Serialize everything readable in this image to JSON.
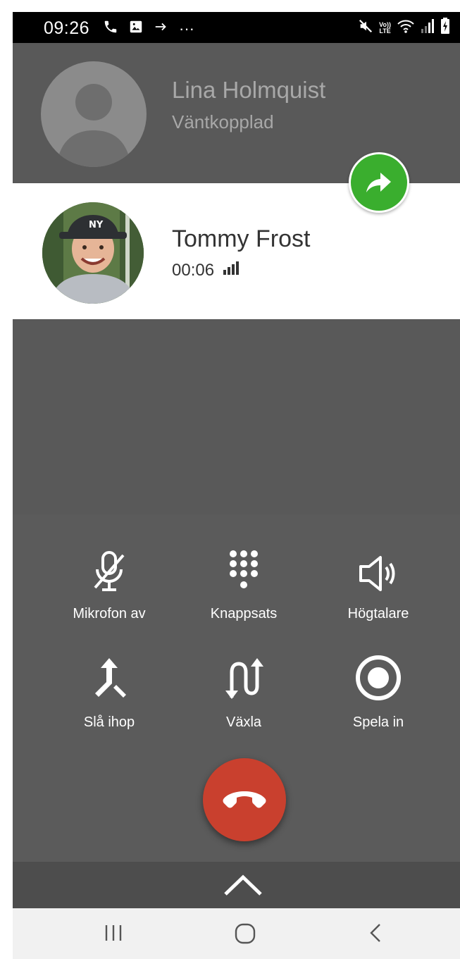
{
  "status_bar": {
    "time": "09:26",
    "left_icons": [
      "phone-icon",
      "image-icon",
      "forward-arrow-icon",
      "more-dots-icon"
    ],
    "overflow_text": "···",
    "right_icons": [
      "mute-icon",
      "volte-icon",
      "wifi-icon",
      "signal-icon",
      "battery-icon"
    ],
    "volte_top": "Vo))",
    "volte_bottom": "LTE"
  },
  "held_call": {
    "name": "Lina Holmquist",
    "status": "Väntkopplad"
  },
  "active_call": {
    "name": "Tommy Frost",
    "duration": "00:06",
    "signal_icon": "signal-bars-icon"
  },
  "controls": {
    "mute_label": "Mikrofon av",
    "keypad_label": "Knappsats",
    "speaker_label": "Högtalare",
    "merge_label": "Slå ihop",
    "swap_label": "Växla",
    "record_label": "Spela in"
  },
  "colors": {
    "background": "#595959",
    "swap_fab": "#3aae2e",
    "hangup": "#c9402e",
    "navbar": "#f1f1f1"
  }
}
